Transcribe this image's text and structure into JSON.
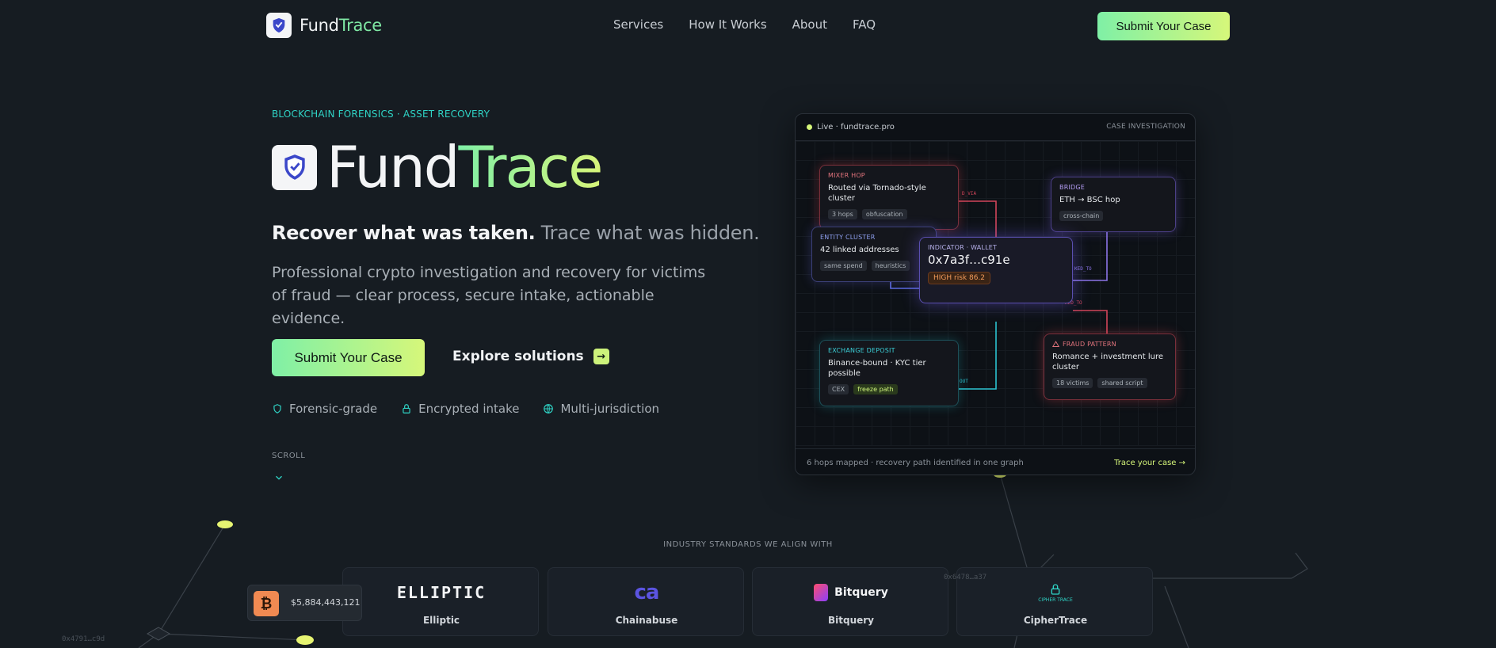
{
  "nav": {
    "brand_part1": "Fund",
    "brand_part2": "Trace",
    "links": [
      "Services",
      "How It Works",
      "About",
      "FAQ"
    ],
    "cta": "Submit Your Case"
  },
  "hero": {
    "eyebrow": "BLOCKCHAIN FORENSICS · ASSET RECOVERY",
    "title_part1": "Fund",
    "title_part2": "Trace",
    "tagline_strong": "Recover what was taken.",
    "tagline_soft": "Trace what was hidden.",
    "description": "Professional crypto investigation and recovery for victims of fraud — clear process, secure intake, actionable evidence.",
    "primary_cta": "Submit Your Case",
    "secondary_cta": "Explore solutions",
    "features": [
      "Forensic-grade",
      "Encrypted intake",
      "Multi-jurisdiction"
    ],
    "scroll_label": "SCROLL"
  },
  "graph_card": {
    "live_label": "Live · fundtrace.pro",
    "case_label": "CASE INVESTIGATION",
    "footer_left": "6 hops mapped · recovery path identified in one graph",
    "footer_right": "Trace your case →",
    "nodes": {
      "mixer": {
        "tag": "MIXER HOP",
        "title": "Routed via Tornado-style cluster",
        "chips": [
          "3 hops",
          "obfuscation"
        ]
      },
      "bridge": {
        "tag": "BRIDGE",
        "title": "ETH → BSC hop",
        "chips": [
          "cross-chain"
        ]
      },
      "entity": {
        "tag": "ENTITY CLUSTER",
        "title": "42 linked addresses",
        "chips": [
          "same spend",
          "heuristics"
        ]
      },
      "wallet": {
        "tag": "INDICATOR · WALLET",
        "title": "0x7a3f…c91e",
        "risk": "HIGH risk 86.2"
      },
      "exchange": {
        "tag": "EXCHANGE DEPOSIT",
        "title": "Binance-bound · KYC tier possible",
        "chips": [
          "CEX",
          "freeze path"
        ]
      },
      "fraud": {
        "tag": "FRAUD PATTERN",
        "title": "Romance + investment lure cluster",
        "chips": [
          "18 victims",
          "shared script"
        ]
      }
    },
    "edge_labels": [
      "D_VIA",
      "KED_TO",
      "KED_TO",
      "OUT"
    ]
  },
  "industry": {
    "label": "INDUSTRY STANDARDS WE ALIGN WITH",
    "partners": [
      {
        "name": "Elliptic",
        "logo_text": "ELLIPTIC"
      },
      {
        "name": "Chainabuse",
        "logo_text": "ca"
      },
      {
        "name": "Bitquery",
        "logo_text": "Bitquery"
      },
      {
        "name": "CipherTrace",
        "logo_text": "CIPHER TRACE"
      }
    ]
  },
  "ticker": {
    "btc_value": "$5,884,443,121",
    "addr_a": "0x4791…c9d",
    "addr_b": "0x6478…a37"
  },
  "colors": {
    "background": "#161c22",
    "accent_green": "#7ff0a6",
    "accent_lime": "#d6f77a",
    "accent_teal": "#2fd4c6"
  }
}
